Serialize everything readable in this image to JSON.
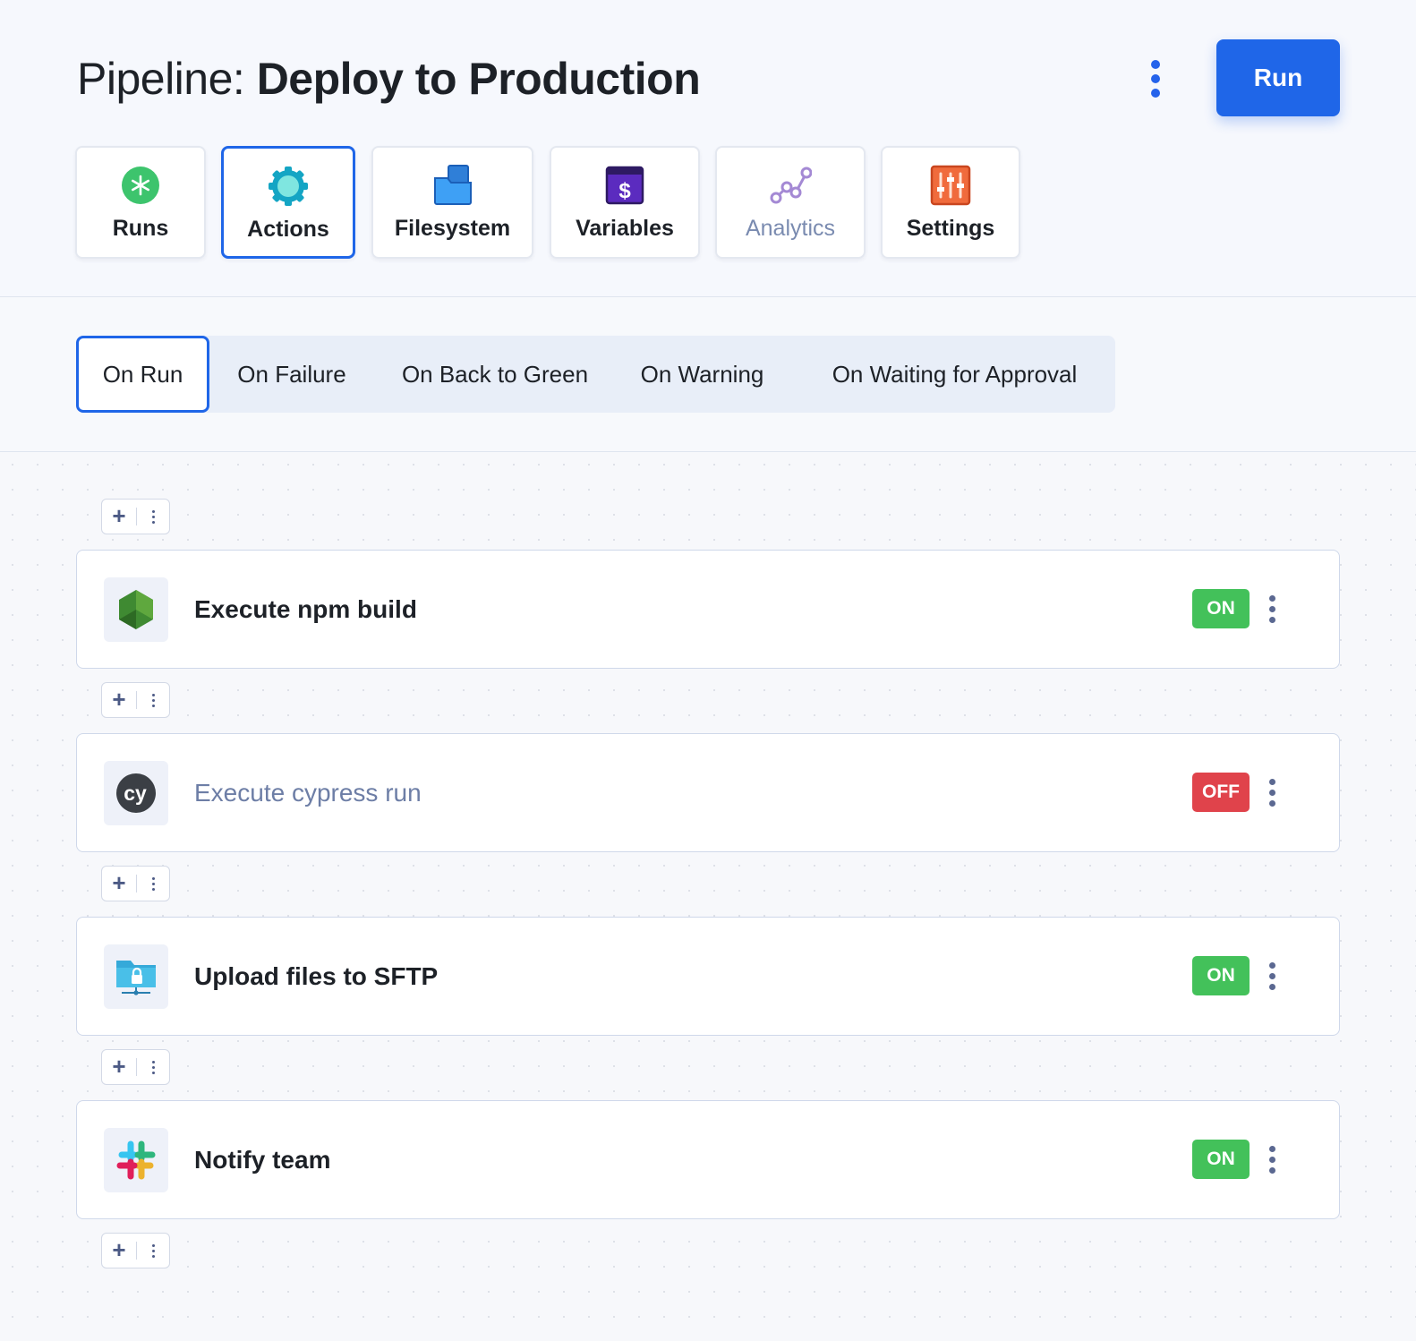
{
  "header": {
    "title_prefix": "Pipeline: ",
    "title_name": "Deploy to Production",
    "more_icon": "vertical-dots-icon",
    "run_label": "Run"
  },
  "nav": {
    "items": [
      {
        "label": "Runs",
        "icon": "asterisk-icon",
        "active": false,
        "enabled": true
      },
      {
        "label": "Actions",
        "icon": "gear-icon",
        "active": true,
        "enabled": true
      },
      {
        "label": "Filesystem",
        "icon": "folder-icon",
        "active": false,
        "enabled": true
      },
      {
        "label": "Variables",
        "icon": "dollar-icon",
        "active": false,
        "enabled": true
      },
      {
        "label": "Analytics",
        "icon": "analytics-icon",
        "active": false,
        "enabled": false
      },
      {
        "label": "Settings",
        "icon": "sliders-icon",
        "active": false,
        "enabled": true
      }
    ]
  },
  "triggers": {
    "tabs": [
      {
        "label": "On Run",
        "active": true
      },
      {
        "label": "On Failure",
        "active": false
      },
      {
        "label": "On Back to Green",
        "active": false
      },
      {
        "label": "On Warning",
        "active": false
      },
      {
        "label": "On Waiting for Approval",
        "active": false
      }
    ]
  },
  "actions": {
    "items": [
      {
        "name": "Execute npm build",
        "icon": "nodejs-icon",
        "status": "ON"
      },
      {
        "name": "Execute cypress run",
        "icon": "cypress-icon",
        "status": "OFF"
      },
      {
        "name": "Upload files to SFTP",
        "icon": "sftp-icon",
        "status": "ON"
      },
      {
        "name": "Notify team",
        "icon": "slack-icon",
        "status": "ON"
      }
    ],
    "insert_label": "+"
  },
  "colors": {
    "accent": "#1f66e8",
    "on": "#43c15a",
    "off": "#e0434b",
    "muted_text": "#6d7ea6"
  }
}
